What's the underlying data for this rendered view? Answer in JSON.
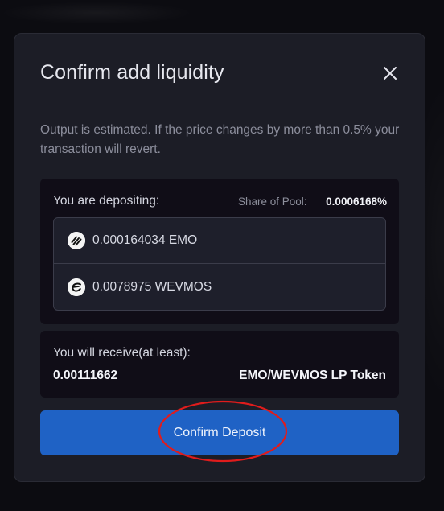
{
  "modal": {
    "title": "Confirm add liquidity",
    "close_icon": "close-icon",
    "notice": "Output is estimated. If the price changes by more than 0.5% your transaction will revert."
  },
  "deposit": {
    "label": "You are depositing:",
    "share_label": "Share of Pool:",
    "share_value": "0.0006168%",
    "tokens": [
      {
        "amount_text": "0.000164034 EMO",
        "icon": "emo-token-icon"
      },
      {
        "amount_text": "0.0078975 WEVMOS",
        "icon": "wevmos-token-icon"
      }
    ]
  },
  "receive": {
    "label": "You will receive(at least):",
    "amount": "0.00111662",
    "token": "EMO/WEVMOS LP Token"
  },
  "confirm": {
    "label": "Confirm Deposit"
  },
  "colors": {
    "modal_bg": "#1c1d26",
    "panel_bg": "#100d17",
    "accent_button": "#1f62c5",
    "annotation": "#e01c1c"
  }
}
